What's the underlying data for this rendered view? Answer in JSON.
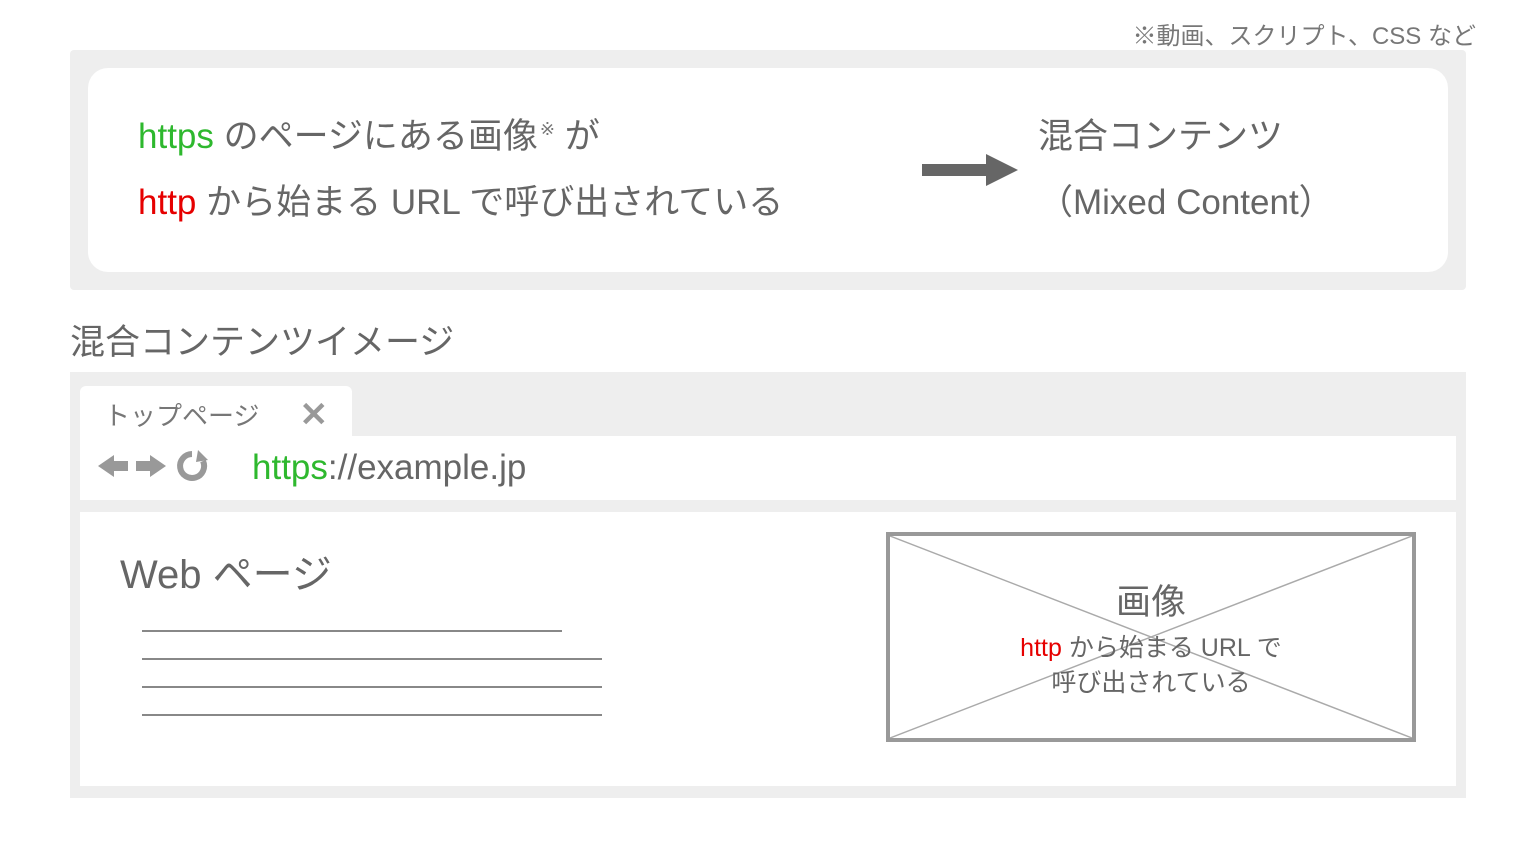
{
  "footnote_top": "※動画、スクリプト、CSS など",
  "explain": {
    "line1_prefix": "https",
    "line1_rest": " のページにある画像",
    "line1_star": "※",
    "line1_suffix": " が",
    "line2_prefix": "http",
    "line2_rest": " から始まる URL で呼び出されている",
    "result_line1": "混合コンテンツ",
    "result_line2": "（Mixed Content）"
  },
  "section_title": "混合コンテンツイメージ",
  "browser": {
    "tab_label": "トップページ",
    "url_scheme": "https",
    "url_rest": "://example.jp"
  },
  "page": {
    "heading": "Web ページ",
    "image_label": "画像",
    "image_sub_prefix": "http",
    "image_sub_rest1": " から始まる URL で",
    "image_sub_rest2": "呼び出されている"
  }
}
